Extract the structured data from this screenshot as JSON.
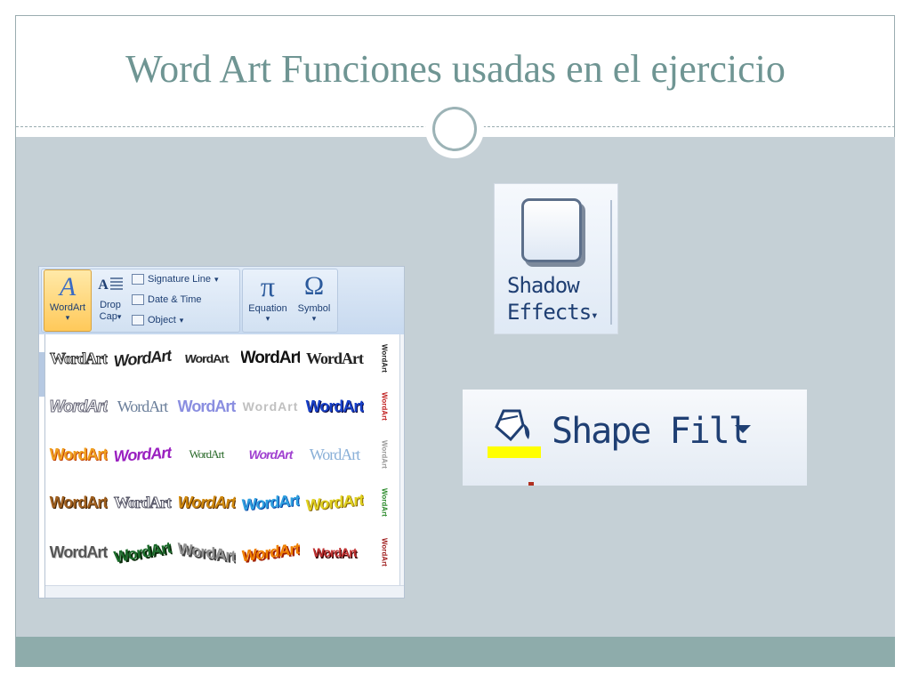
{
  "slide": {
    "title": "Word Art Funciones usadas en el ejercicio"
  },
  "ribbon": {
    "wordart_label": "WordArt",
    "dropcap_label_1": "Drop",
    "dropcap_label_2": "Cap",
    "signature_line_label": "Signature Line",
    "date_time_label": "Date & Time",
    "object_label": "Object",
    "equation_label": "Equation",
    "symbol_label": "Symbol",
    "wordart_icon_glyph": "A",
    "equation_glyph": "π",
    "symbol_glyph": "Ω",
    "dropdown_glyph": "▾"
  },
  "gallery": {
    "rows": [
      [
        "WordArt",
        "WordArt",
        "WordArt",
        "WordArt",
        "WordArt"
      ],
      [
        "WordArt",
        "WordArt",
        "WordArt",
        "WordArt",
        "WordArt"
      ],
      [
        "WordArt",
        "WordArt",
        "WordArt",
        "WordArt",
        "WordArt"
      ],
      [
        "WordArt",
        "WordArt",
        "WordArt",
        "WordArt",
        "WordArt"
      ],
      [
        "WordArt",
        "WordArt",
        "WordArt",
        "WordArt",
        "WordArt"
      ]
    ],
    "vertical": [
      "WordArt",
      "WordArt",
      "WordArt",
      "WordArt",
      "WordArt"
    ]
  },
  "shadow_effects": {
    "label_1": "Shadow",
    "label_2": "Effects",
    "dropdown_glyph": "▾"
  },
  "shape_fill": {
    "label": "Shape Fill",
    "fill_color": "#ffff00"
  },
  "colors": {
    "title": "#6f9593",
    "content_background": "#c5d0d6",
    "footer_band": "#8eacab",
    "ribbon_text": "#1f3f73"
  }
}
